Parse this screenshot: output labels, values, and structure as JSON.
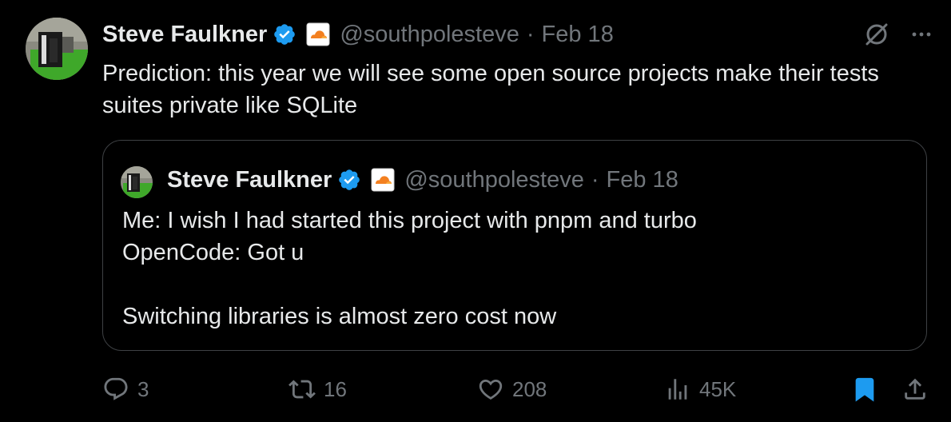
{
  "tweet": {
    "author": {
      "name": "Steve Faulkner",
      "handle": "@southpolesteve",
      "verified": true,
      "affiliate_badge": "cloudflare-logo"
    },
    "separator": "·",
    "date": "Feb 18",
    "text": "Prediction: this year we will see some open source projects make their tests\nsuites private like SQLite",
    "top_icons": [
      "grok-icon",
      "more-icon"
    ],
    "quote": {
      "author": {
        "name": "Steve Faulkner",
        "handle": "@southpolesteve",
        "verified": true,
        "affiliate_badge": "cloudflare-logo"
      },
      "separator": "·",
      "date": "Feb 18",
      "text": "Me: I wish I had started this project with pnpm and turbo\nOpenCode: Got u\n\nSwitching libraries is almost zero cost now"
    },
    "actions": {
      "replies": "3",
      "reposts": "16",
      "likes": "208",
      "views": "45K",
      "bookmarked": true
    }
  },
  "colors": {
    "background": "#000000",
    "text_primary": "#e7e9ea",
    "text_secondary": "#71767b",
    "verified_blue": "#1d9bf0",
    "bookmark_active": "#1d9bf0",
    "quote_border": "#3e4144",
    "cloudflare_orange": "#f38020"
  }
}
